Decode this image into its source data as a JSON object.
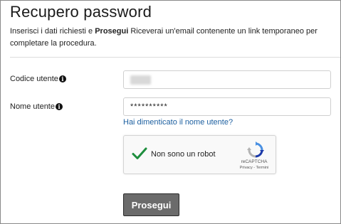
{
  "page": {
    "title": "Recupero password",
    "intro_before": "Inserisci i dati richiesti e ",
    "intro_bold": "Prosegui",
    "intro_after": " Riceverai un'email contenente un link temporaneo per completare la procedura."
  },
  "form": {
    "user_code_label": "Codice utente",
    "user_code_value": "",
    "user_name_label": "Nome utente",
    "user_name_value": "**********",
    "forgot_username_link": "Hai dimenticato il nome utente?",
    "info_icon_glyph": "i"
  },
  "captcha": {
    "label": "Non sono un robot",
    "brand": "reCAPTCHA",
    "links": "Privacy - Termini",
    "check_color": "#1e8e3e"
  },
  "actions": {
    "submit_label": "Prosegui"
  },
  "colors": {
    "link": "#1c5fa0",
    "button_bg": "#6b6b6b"
  }
}
